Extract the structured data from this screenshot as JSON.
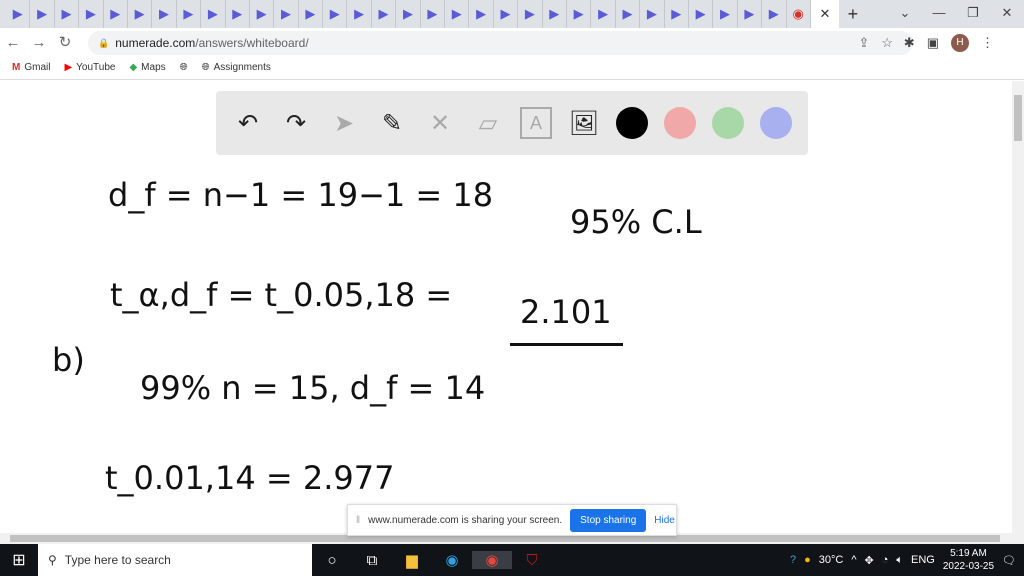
{
  "browser": {
    "tab_count": 32,
    "tab_icon": "numerade-play-icon",
    "url_host": "numerade.com",
    "url_path": "/answers/whiteboard/",
    "bookmarks": [
      {
        "label": "Gmail",
        "icon": "gmail-icon"
      },
      {
        "label": "YouTube",
        "icon": "youtube-icon"
      },
      {
        "label": "Maps",
        "icon": "maps-icon"
      },
      {
        "label": "",
        "icon": "globe-icon"
      },
      {
        "label": "Assignments",
        "icon": "globe-icon"
      }
    ],
    "avatar_letter": "H"
  },
  "whiteboard": {
    "tools": [
      "undo",
      "redo",
      "select",
      "pen",
      "tools",
      "eraser",
      "text",
      "image"
    ],
    "colors": [
      "#000000",
      "#f0a8a8",
      "#a8d8a8",
      "#a8b0f0"
    ],
    "lines": {
      "l1": "d_f = n−1 = 19−1 = 18",
      "l1b": "95% C.L",
      "l2": "t_α,d_f = t_0.05,18 = ",
      "l2v": "2.101",
      "l3a": "b)",
      "l3": "99%  n = 15,  d_f = 14",
      "l4": "t_0.01,14 = 2.977"
    }
  },
  "share_bar": {
    "text": "www.numerade.com is sharing your screen.",
    "stop": "Stop sharing",
    "hide": "Hide"
  },
  "taskbar": {
    "search_placeholder": "Type here to search",
    "temperature": "30°C",
    "lang": "ENG",
    "time": "5:19 AM",
    "date": "2022-03-25",
    "notifications": "1"
  }
}
